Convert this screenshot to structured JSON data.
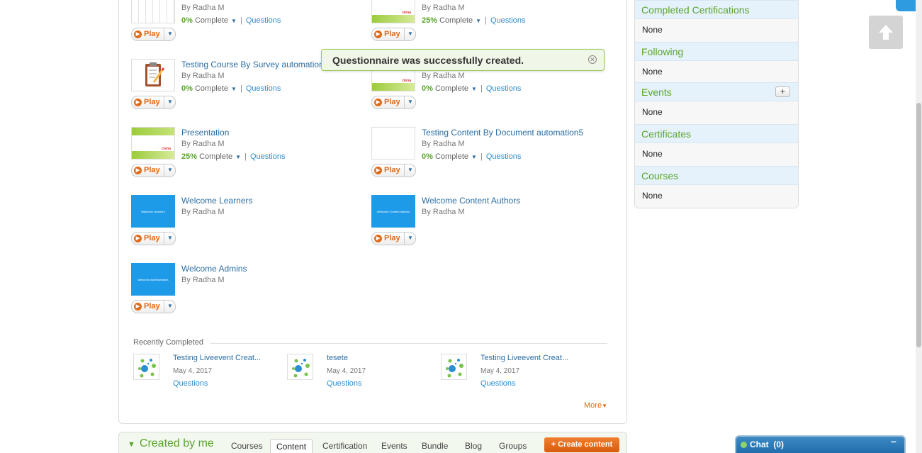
{
  "toast": {
    "message": "Questionnaire was successfully created."
  },
  "play_label": "Play",
  "complete_label": "Complete",
  "questions_label": "Questions",
  "content_items": [
    {
      "title": "",
      "author": "By Radha M",
      "percent": "0%",
      "thumb": "grid"
    },
    {
      "title": "",
      "author": "By Radha M",
      "percent": "25%",
      "thumb": "green"
    },
    {
      "title": "Testing Course By Survey automation",
      "author": "By Radha M",
      "percent": "0%",
      "thumb": "survey"
    },
    {
      "title": "",
      "author": "By Radha M",
      "percent": "0%",
      "thumb": "green"
    },
    {
      "title": "Presentation",
      "author": "By Radha M",
      "percent": "25%",
      "thumb": "green"
    },
    {
      "title": "Testing Content By Document automation5",
      "author": "By Radha M",
      "percent": "0%",
      "thumb": "doc"
    },
    {
      "title": "Welcome Learners",
      "author": "By Radha M",
      "thumb": "blue",
      "thumb_text": "Welcome Learners"
    },
    {
      "title": "Welcome Content Authors",
      "author": "By Radha M",
      "thumb": "blue",
      "thumb_text": "Welcome Content Authors"
    },
    {
      "title": "Welcome Admins",
      "author": "By Radha M",
      "thumb": "blue",
      "thumb_text": "Welcome Administrators"
    }
  ],
  "thumb_logo": "ciena",
  "recently_completed": {
    "label": "Recently Completed",
    "items": [
      {
        "title": "Testing Liveevent Creat...",
        "date": "May 4, 2017",
        "link": "Questions"
      },
      {
        "title": "tesete",
        "date": "May 4, 2017",
        "link": "Questions"
      },
      {
        "title": "Testing Liveevent Creat...",
        "date": "May 4, 2017",
        "link": "Questions"
      }
    ],
    "more_label": "More"
  },
  "created_by_me": {
    "title": "Created by me",
    "tabs": [
      "Courses",
      "Content",
      "Certification",
      "Events",
      "Bundle",
      "Blog",
      "Groups"
    ],
    "active_tab": "Content",
    "create_button": "+ Create content"
  },
  "sidebar": {
    "sections": [
      {
        "heading": "Completed Certifications",
        "value": "None",
        "has_add": false
      },
      {
        "heading": "Following",
        "value": "None",
        "has_add": false
      },
      {
        "heading": "Events",
        "value": "None",
        "has_add": true
      },
      {
        "heading": "Certificates",
        "value": "None",
        "has_add": false
      },
      {
        "heading": "Courses",
        "value": "None",
        "has_add": false
      }
    ],
    "add_symbol": "+"
  },
  "chat": {
    "label": "Chat",
    "count": "(0)",
    "minimize_symbol": "–"
  },
  "icons": {
    "scroll_top": "arrow-up-icon",
    "play": "play-circle-icon",
    "dropdown": "caret-down-icon",
    "close": "close-circle-icon"
  }
}
